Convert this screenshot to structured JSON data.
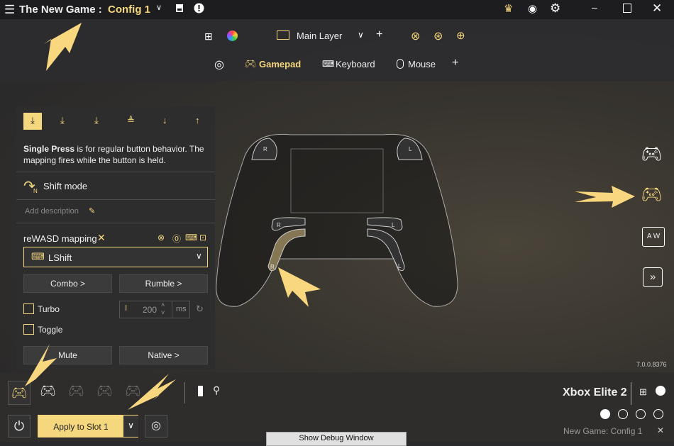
{
  "title": {
    "game": "The New Game :",
    "config": "Config 1"
  },
  "layer": {
    "label": "Main Layer"
  },
  "tabs": [
    {
      "label": "Gamepad",
      "active": true
    },
    {
      "label": "Keyboard"
    },
    {
      "label": "Mouse"
    }
  ],
  "panel": {
    "description_bold": "Single Press",
    "description": " is for regular button behavior. The mapping fires while the button is held.",
    "shift_mode": "Shift mode",
    "shift_badge": "N",
    "add_description": "Add description",
    "mapping_label": "reWASD mapping",
    "mapping_value": "LShift",
    "combo": "Combo >",
    "rumble": "Rumble >",
    "turbo": "Turbo",
    "toggle": "Toggle",
    "turbo_value": "200",
    "turbo_unit": "ms",
    "mute": "Mute",
    "native": "Native >"
  },
  "controller": {
    "labels": {
      "r": "R",
      "l": "L"
    }
  },
  "version": "7.0.0.8376",
  "bottom": {
    "device": "Xbox Elite 2",
    "apply": "Apply to Slot 1",
    "slot_config": "New Game: Config 1",
    "debug": "Show Debug Window",
    "slots_active": 1,
    "slots_total": 4
  },
  "colors": {
    "accent": "#f5d77d",
    "bg": "#2d2d2e"
  }
}
